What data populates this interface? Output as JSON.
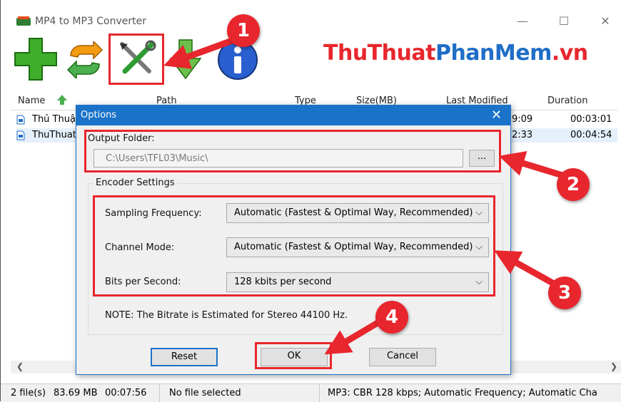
{
  "window": {
    "title": "MP4 to MP3 Converter",
    "minimize": "—",
    "maximize": "☐",
    "close": "✕"
  },
  "toolbar": {
    "buttons": [
      "add-icon",
      "convert-icon",
      "options-icon",
      "download-icon",
      "info-icon"
    ],
    "brand_part1": "ThuThuat",
    "brand_part2": "PhanMem",
    "brand_part3": ".vn"
  },
  "list": {
    "columns": {
      "name": "Name",
      "path": "Path",
      "type": "Type",
      "size": "Size(MB)",
      "modified": "Last Modified",
      "duration": "Duration"
    },
    "rows": [
      {
        "name": "Thủ Thuậ",
        "modified_tail": "9:09",
        "duration": "00:03:01"
      },
      {
        "name": "ThuThuat",
        "modified_tail": "2:33",
        "duration": "00:04:54"
      }
    ]
  },
  "status": {
    "files": "2 file(s)",
    "size": "83.69 MB",
    "time": "00:07:56",
    "selection": "No file selected",
    "format": "MP3:  CBR 128 kbps; Automatic Frequency; Automatic Cha"
  },
  "dialog": {
    "title": "Options",
    "close": "✕",
    "output_label": "Output Folder:",
    "output_value": "C:\\Users\\TFL03\\Music\\",
    "browse": "...",
    "encoder_group": "Encoder Settings",
    "sampling_label": "Sampling Frequency:",
    "sampling_value": "Automatic (Fastest & Optimal Way, Recommended)",
    "channel_label": "Channel Mode:",
    "channel_value": "Automatic (Fastest & Optimal Way, Recommended)",
    "bits_label": "Bits per Second:",
    "bits_value": "128 kbits per second",
    "note": "NOTE: The Bitrate is Estimated  for Stereo 44100 Hz.",
    "reset": "Reset",
    "ok": "OK",
    "cancel": "Cancel"
  },
  "annotations": {
    "n1": "1",
    "n2": "2",
    "n3": "3",
    "n4": "4"
  },
  "colors": {
    "accent": "#1a73c9",
    "annotation_red": "#e8262d"
  }
}
